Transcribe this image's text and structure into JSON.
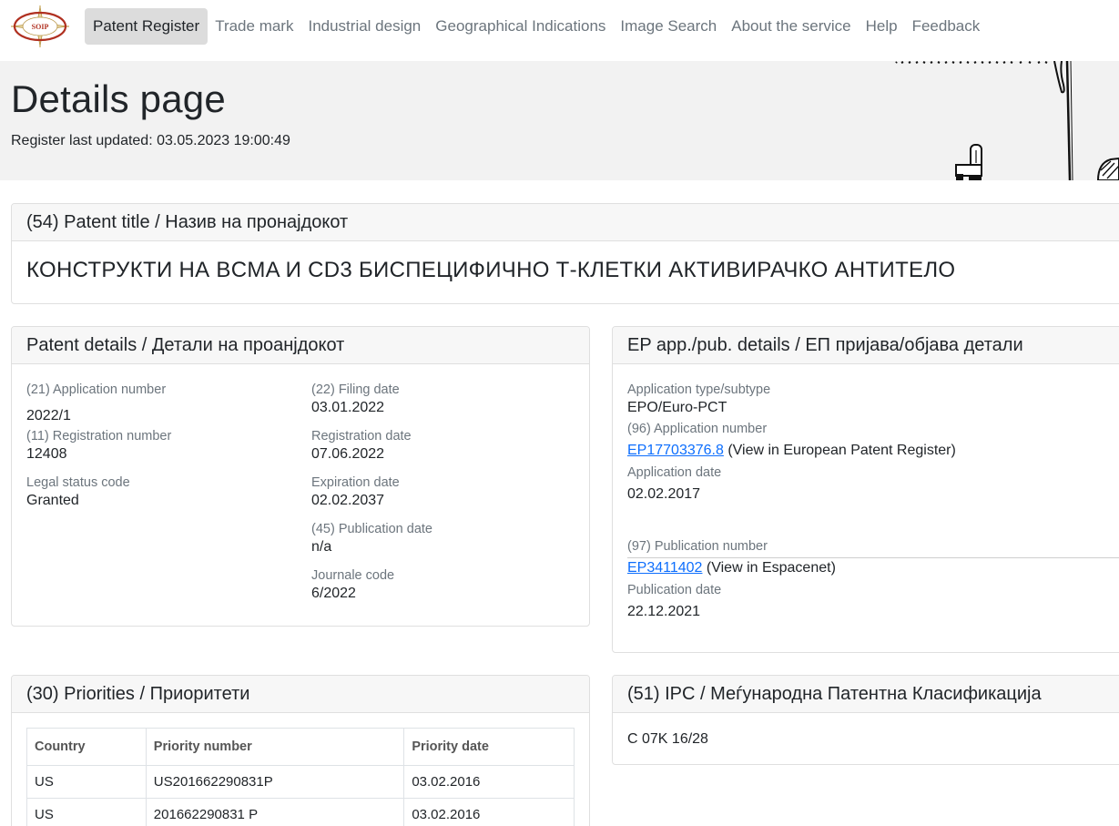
{
  "logo": {
    "text": "SOIP"
  },
  "nav": {
    "items": [
      "Patent Register",
      "Trade mark",
      "Industrial design",
      "Geographical Indications",
      "Image Search",
      "About the service",
      "Help",
      "Feedback"
    ],
    "active": "Patent Register"
  },
  "hero": {
    "title": "Details page",
    "subtitle": "Register last updated: 03.05.2023 19:00:49"
  },
  "title_card": {
    "header": "(54) Patent title / Назив на пронајдокот",
    "title": "КОНСТРУКТИ НА BCMA И CD3 БИСПЕЦИФИЧНО Т-КЛЕТКИ АКТИВИРАЧКО АНТИТЕЛО"
  },
  "details": {
    "header": "Patent details / Детали на проанјдокот",
    "app_number_label": "(21) Application number",
    "app_number": "2022/1",
    "reg_number_label": "(11) Registration number",
    "reg_number": "12408",
    "legal_label": "Legal status code",
    "legal": "Granted",
    "filing_label": "(22) Filing date",
    "filing": "03.01.2022",
    "reg_date_label": "Registration date",
    "reg_date": "07.06.2022",
    "exp_label": "Expiration date",
    "exp": "02.02.2037",
    "pub_label": "(45) Publication date",
    "pub": "n/a",
    "journal_label": "Journale code",
    "journal": "6/2022"
  },
  "ep": {
    "header": "EP app./pub. details / ЕП пријава/објава детали",
    "type_label": "Application type/subtype",
    "type": "EPO/Euro-PCT",
    "app_label": "(96) Application number",
    "app_link": "EP17703376.8",
    "app_suffix": " (View in European Patent Register)",
    "app_date_label": "Application date",
    "app_date": "02.02.2017",
    "pub_label": "(97) Publication number",
    "pub_link": "EP3411402",
    "pub_suffix": " (View in Espacenet)",
    "pub_date_label": "Publication date",
    "pub_date": "22.12.2021"
  },
  "priorities": {
    "header": "(30) Priorities / Приоритети",
    "columns": [
      "Country",
      "Priority number",
      "Priority date"
    ],
    "rows": [
      [
        "US",
        "US201662290831P",
        "03.02.2016"
      ],
      [
        "US",
        "201662290831 P",
        "03.02.2016"
      ]
    ]
  },
  "ipc": {
    "header": "(51) IPC / Меѓународна Патентна Класификација",
    "value": "C 07K 16/28"
  }
}
